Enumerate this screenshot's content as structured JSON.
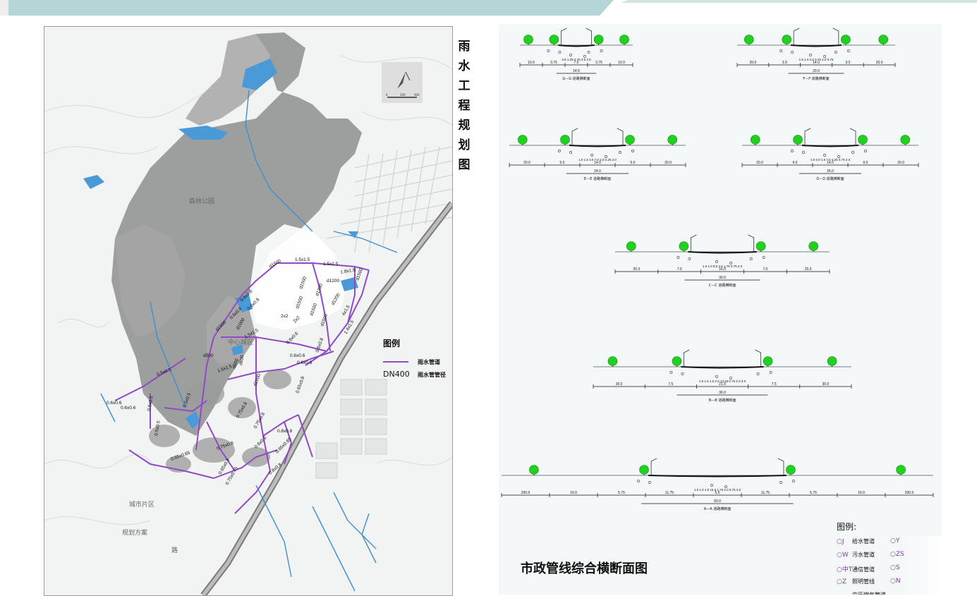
{
  "map": {
    "title_chars": [
      "雨",
      "水",
      "工",
      "程",
      "规",
      "划",
      "图"
    ],
    "legend": {
      "title": "图例",
      "line_label": "雨水管道",
      "size_key": "DN400",
      "size_label": "雨水管管径"
    },
    "pipe_labels": [
      "1.5x1.5",
      "1.5x1.5",
      "1.8x1.8",
      "d1500",
      "d1500",
      "d1500",
      "d1200",
      "d1200",
      "d1200",
      "d1500",
      "d1500",
      "d1500",
      "4x1.5",
      "1.4x1.5",
      "2x2",
      "2x2",
      "0.6x0.6",
      "0.6x0.8",
      "0.6x0.8",
      "0.6x0.6",
      "d1500",
      "d1000",
      "1.5x1.5",
      "0.6x0.6",
      "0.6x0.6",
      "0.65x0.8",
      "0.6x0.8",
      "d600",
      "d500",
      "d600",
      "1.5x1.5",
      "d1500",
      "0.75x0.8",
      "0.75x0.8",
      "0.6x0.6",
      "0.5x0.5",
      "0.5x0.5",
      "0.6x0.6",
      "0.65x0.65",
      "0.65x0.8",
      "0.6x0.6",
      "0.5x0.5",
      "0.75x0.8",
      "0.8x0.8",
      "0.65x0.65",
      "0.75x0.75",
      "0.8x0.8",
      "0.5x0.5"
    ],
    "place_labels": [
      "森林公园",
      "中心城区",
      "城市片区",
      "规划方案",
      "路"
    ],
    "scale_ticks": [
      "0",
      "200",
      "400"
    ]
  },
  "sections": {
    "title": "市政管线综合横断面图",
    "items": [
      {
        "id": "G-G",
        "label": "G—G 道路横断面",
        "dims": [
          "10.0",
          "3.75",
          "7.0",
          "3.75",
          "10.0",
          "14.5"
        ],
        "small": "3.5 1.25 0.75 3.5 2.5"
      },
      {
        "id": "F-F",
        "label": "F—F 道路横断面",
        "dims": [
          "20.0",
          "3.0",
          "14.0",
          "3.0",
          "20.0",
          "20.0"
        ],
        "small": "1.5 1.0 2.0 0.75 2.0 0.75"
      },
      {
        "id": "E-E",
        "label": "E—E 道路横断面",
        "dims": [
          "20.0",
          "5.0",
          "14.0",
          "5.0",
          "20.0",
          "24.0"
        ],
        "small": "1.0 1.5 3.0 7.0 2.0 2.25 2.0"
      },
      {
        "id": "D-D",
        "label": "D—D 道路横断面",
        "dims": [
          "20.0",
          "6.0",
          "14.0",
          "6.0",
          "20.0",
          "26.0"
        ],
        "small": "1.0 3.0 1.5 7.0 4.25 0.75 2.0"
      },
      {
        "id": "C-C",
        "label": "C—C 道路横断面",
        "dims": [
          "25.0",
          "7.0",
          "16.0",
          "7.0",
          "25.0",
          "30.0"
        ],
        "small": "1.5 1.0 8.0 2.5 1.75 0.75 2.0"
      },
      {
        "id": "B-B",
        "label": "B—B 道路横断面",
        "dims": [
          "30.0",
          "7.5",
          "21.0",
          "7.5",
          "30.0",
          "36.0"
        ],
        "small": "1.5 1.5 1.5 2.0 13.25 0.75 2.0 2.0"
      },
      {
        "id": "A-A",
        "label": "A—A 道路横断面",
        "dims": [
          "200.0",
          "10.0",
          "5.75",
          "11.75",
          "5.0",
          "11.75",
          "5.75",
          "10.0",
          "200.0",
          "60.0"
        ],
        "small": "1.0 1.0 1.5 15.5 1.75 2.0 0.75 2.0"
      }
    ],
    "legend": {
      "title": "图例:",
      "items": [
        {
          "sym": "J",
          "label": "给水管道"
        },
        {
          "sym": "W",
          "label": "污水管道"
        },
        {
          "sym": "中T",
          "label": "通信管道"
        },
        {
          "sym": "Z",
          "label": "照明管线"
        }
      ],
      "right_syms": [
        "Y",
        "ZS",
        "S",
        "N"
      ],
      "cut_text": "中压燃气管道"
    }
  }
}
